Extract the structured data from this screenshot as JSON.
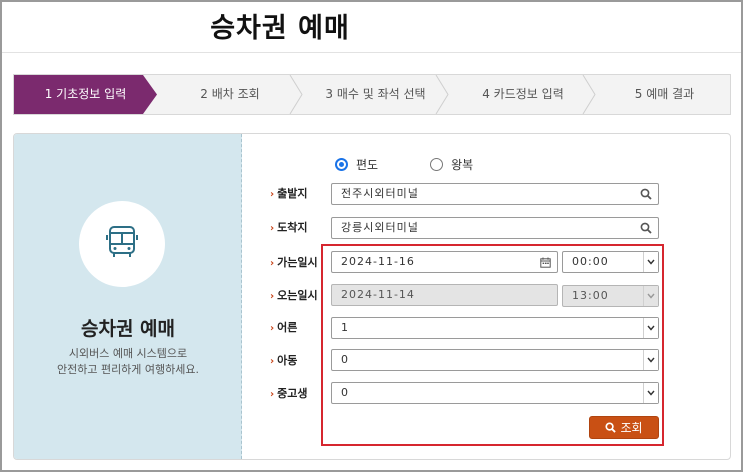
{
  "page": {
    "title": "승차권 예매"
  },
  "steps": [
    {
      "label": "1 기초정보 입력",
      "active": true
    },
    {
      "label": "2 배차 조회",
      "active": false
    },
    {
      "label": "3 매수 및 좌석 선택",
      "active": false
    },
    {
      "label": "4 카드정보 입력",
      "active": false
    },
    {
      "label": "5 예매 결과",
      "active": false
    }
  ],
  "intro": {
    "icon": "bus-icon",
    "title": "승차권 예매",
    "desc_line1": "시외버스 예매 시스템으로",
    "desc_line2": "안전하고 편리하게 여행하세요."
  },
  "trip_type": {
    "one_way": "편도",
    "round_trip": "왕복",
    "selected": "one_way"
  },
  "form": {
    "departure": {
      "label": "출발지",
      "value": "전주시외터미널"
    },
    "arrival": {
      "label": "도착지",
      "value": "강릉시외터미널"
    },
    "depart_date": {
      "label": "가는일시",
      "date": "2024-11-16",
      "time": "00:00"
    },
    "return_date": {
      "label": "오는일시",
      "date": "2024-11-14",
      "time": "13:00"
    },
    "adult": {
      "label": "어른",
      "value": "1"
    },
    "child": {
      "label": "아동",
      "value": "0"
    },
    "student": {
      "label": "중고생",
      "value": "0"
    }
  },
  "search_button": {
    "label": "조회"
  },
  "colors": {
    "accent": "#7b2a6e",
    "button": "#c95014",
    "highlight": "#d6262f",
    "intro_bg": "#d4e7ee"
  }
}
